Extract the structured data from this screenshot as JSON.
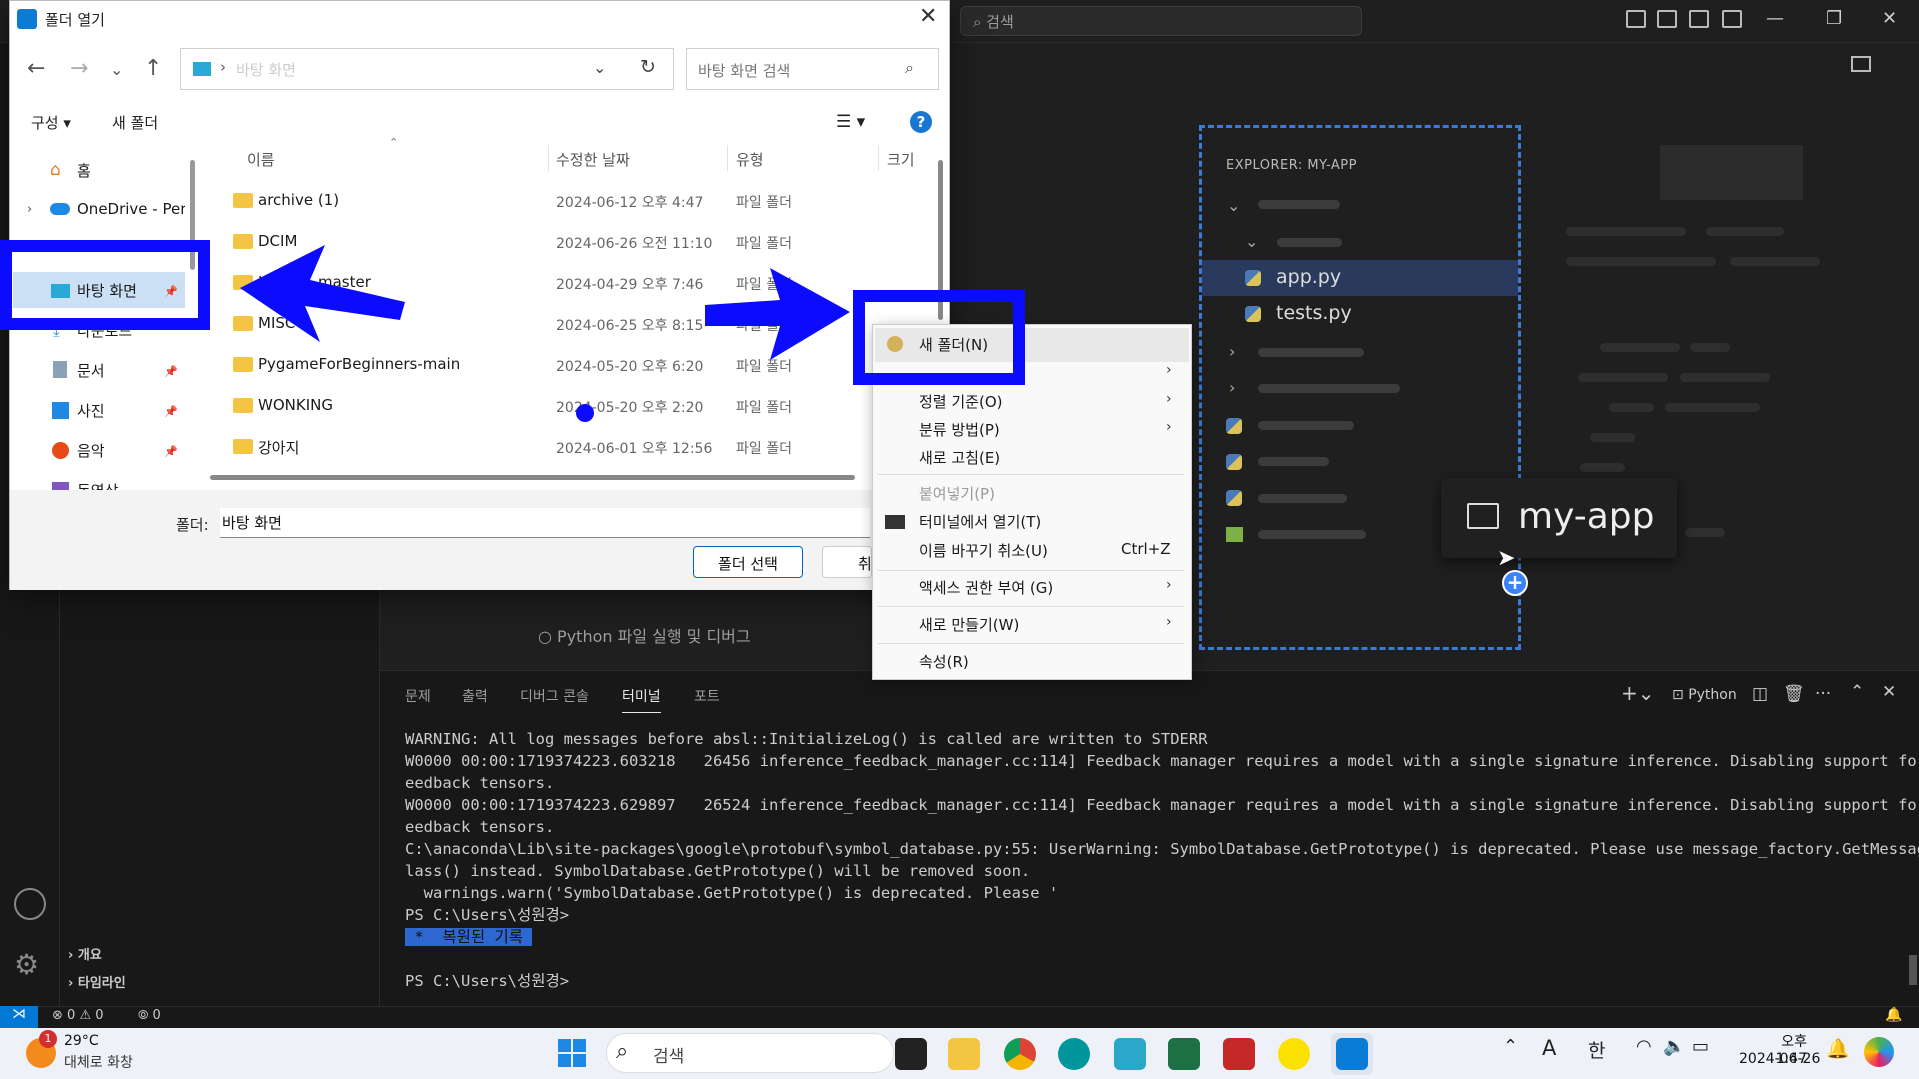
{
  "vscode": {
    "search_placeholder": "검색",
    "hint_text": "Python 파일 실행 및 디버그",
    "sidebar_sections": [
      "개요",
      "타임라인"
    ],
    "explorer": {
      "header": "EXPLORER: MY-APP",
      "files": [
        "app.py",
        "tests.py"
      ],
      "drag_label": "my-app"
    },
    "panel_tabs": [
      "문제",
      "출력",
      "디버그 콘솔",
      "터미널",
      "포트"
    ],
    "panel_active_tab": "터미널",
    "terminal_profile": "Python",
    "terminal_lines": [
      "WARNING: All log messages before absl::InitializeLog() is called are written to STDERR",
      "W0000 00:00:1719374223.603218   26456 inference_feedback_manager.cc:114] Feedback manager requires a model with a single signature inference. Disabling support for f",
      "eedback tensors.",
      "W0000 00:00:1719374223.629897   26524 inference_feedback_manager.cc:114] Feedback manager requires a model with a single signature inference. Disabling support for f",
      "eedback tensors.",
      "C:\\anaconda\\Lib\\site-packages\\google\\protobuf\\symbol_database.py:55: UserWarning: SymbolDatabase.GetPrototype() is deprecated. Please use message_factory.GetMessageC",
      "lass() instead. SymbolDatabase.GetPrototype() will be removed soon.",
      "  warnings.warn('SymbolDatabase.GetPrototype() is deprecated. Please '",
      "PS C:\\Users\\성원경>"
    ],
    "restored_label": " *  복원된 기록 ",
    "prompt": "PS C:\\Users\\성원경>",
    "status": {
      "errors": "0",
      "warnings": "0",
      "ports": "0"
    }
  },
  "dialog": {
    "title": "폴더 열기",
    "address": "바탕 화면",
    "search_placeholder": "바탕 화면 검색",
    "toolbar": {
      "organize": "구성",
      "new_folder": "새 폴더"
    },
    "nav_items": [
      "홈",
      "OneDrive - Pers",
      "바탕 화면",
      "다운로드",
      "문서",
      "사진",
      "음악",
      "동영상"
    ],
    "columns": [
      "이름",
      "수정한 날짜",
      "유형",
      "크기"
    ],
    "files": [
      {
        "name": "archive (1)",
        "date": "2024-06-12 오후 4:47",
        "type": "파일 폴더"
      },
      {
        "name": "DCIM",
        "date": "2024-06-26 오전 11:10",
        "type": "파일 폴더"
      },
      {
        "name": "Level-1-master",
        "date": "2024-04-29 오후 7:46",
        "type": "파일 폴더"
      },
      {
        "name": "MISC",
        "date": "2024-06-25 오후 8:15",
        "type": "파일 폴더"
      },
      {
        "name": "PygameForBeginners-main",
        "date": "2024-05-20 오후 6:20",
        "type": "파일 폴더"
      },
      {
        "name": "WONKING",
        "date": "2024-05-20 오후 2:20",
        "type": "파일 폴더"
      },
      {
        "name": "강아지",
        "date": "2024-06-01 오후 12:56",
        "type": "파일 폴더"
      }
    ],
    "folder_label": "폴더:",
    "folder_value": "바탕 화면",
    "select_button": "폴더 선택",
    "cancel_button": "취소"
  },
  "context_menu": {
    "items": [
      {
        "label": "새 폴더(N)",
        "submenu": false
      },
      {
        "label": "",
        "submenu": true
      },
      {
        "label": "정렬 기준(O)",
        "submenu": true
      },
      {
        "label": "분류 방법(P)",
        "submenu": true
      },
      {
        "label": "새로 고침(E)",
        "submenu": false
      },
      {
        "label": "붙여넣기(P)",
        "submenu": false,
        "disabled": true
      },
      {
        "label": "터미널에서 열기(T)",
        "submenu": false
      },
      {
        "label": "이름 바꾸기 취소(U)",
        "shortcut": "Ctrl+Z"
      },
      {
        "label": "액세스 권한 부여 (G)",
        "submenu": true
      },
      {
        "label": "새로 만들기(W)",
        "submenu": true
      },
      {
        "label": "속성(R)",
        "submenu": false
      }
    ]
  },
  "taskbar": {
    "weather_temp": "29°C",
    "weather_desc": "대체로 화창",
    "weather_badge": "1",
    "search_placeholder": "검색",
    "ime": "한",
    "font_glyph": "A",
    "time": "오후 1:47",
    "date": "2024-06-26"
  },
  "colors": {
    "annotation_blue": "#0b0bff",
    "vscode_accent": "#0078d4"
  }
}
